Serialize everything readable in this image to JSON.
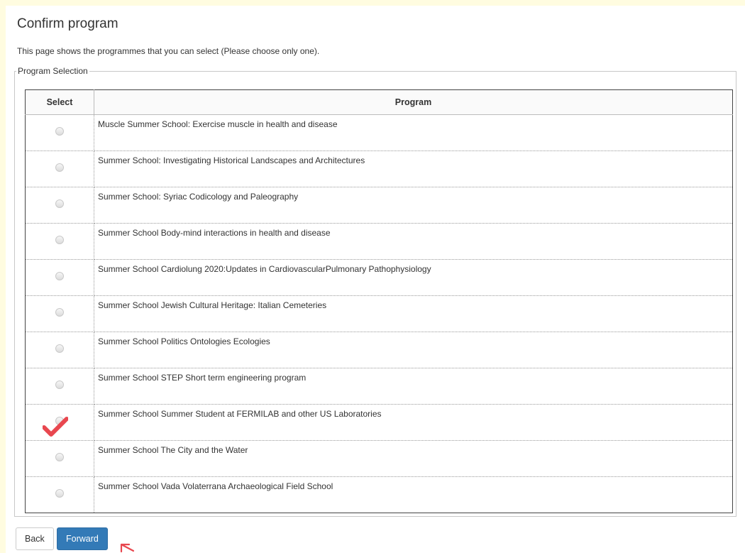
{
  "page": {
    "title": "Confirm program",
    "intro": "This page shows the programmes that you can select (Please choose only one)."
  },
  "selection": {
    "legend": "Program Selection",
    "columns": {
      "select": "Select",
      "program": "Program"
    },
    "programs": [
      {
        "name": "Muscle Summer School: Exercise muscle in health and disease"
      },
      {
        "name": "Summer School: Investigating Historical Landscapes and Architectures"
      },
      {
        "name": "Summer School: Syriac Codicology and Paleography"
      },
      {
        "name": "Summer School Body-mind interactions in health and disease"
      },
      {
        "name": "Summer School Cardiolung 2020:Updates in CardiovascularPulmonary Pathophysiology"
      },
      {
        "name": "Summer School Jewish Cultural Heritage: Italian Cemeteries"
      },
      {
        "name": "Summer School Politics Ontologies Ecologies"
      },
      {
        "name": "Summer School STEP Short term engineering program"
      },
      {
        "name": "Summer School Summer Student at FERMILAB and other US Laboratories"
      },
      {
        "name": "Summer School The City and the Water"
      },
      {
        "name": "Summer School Vada Volaterrana Archaeological Field School"
      }
    ]
  },
  "annotations": {
    "check_mark_color": "#e8474f",
    "check_mark_icon": "check-mark-icon",
    "arrow_icon": "arrow-pointer-icon"
  },
  "buttons": {
    "back": "Back",
    "forward": "Forward"
  },
  "colors": {
    "background": "#fffce0",
    "primary": "#337ab7"
  }
}
